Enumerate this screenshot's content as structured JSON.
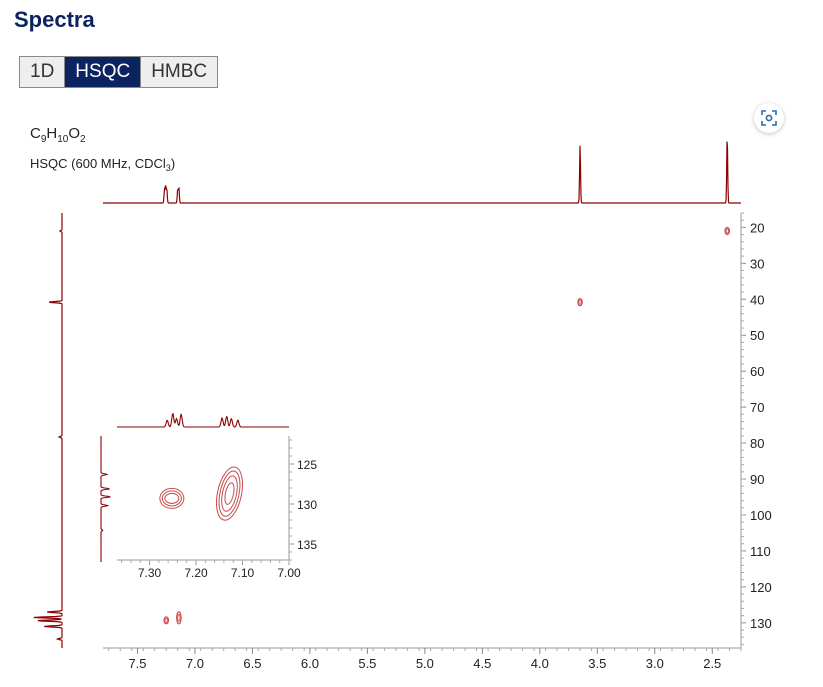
{
  "page": {
    "title": "Spectra"
  },
  "tabs": [
    {
      "label": "1D",
      "active": false
    },
    {
      "label": "HSQC",
      "active": true
    },
    {
      "label": "HMBC",
      "active": false
    }
  ],
  "toolbar": {
    "scan_icon": "focus-scan-icon"
  },
  "colors": {
    "accent": "#0b2361",
    "spectrum": "#8b0000",
    "contour": "#c84b4b"
  },
  "chart_data": {
    "type": "heatmap",
    "formula": {
      "c": "C",
      "c_n": "9",
      "h": "H",
      "h_n": "10",
      "o": "O",
      "o_n": "2"
    },
    "experiment": {
      "prefix": "HSQC (600 MHz, CDCl",
      "sub": "3",
      "suffix": ")"
    },
    "x_axis": {
      "reversed": true,
      "range": [
        7.8,
        2.25
      ],
      "ticks": [
        7.5,
        7.0,
        6.5,
        6.0,
        5.5,
        5.0,
        4.5,
        4.0,
        3.5,
        3.0,
        2.5
      ],
      "tick_labels": [
        "7.5",
        "7.0",
        "6.5",
        "6.0",
        "5.5",
        "5.0",
        "4.5",
        "4.0",
        "3.5",
        "3.0",
        "2.5"
      ]
    },
    "y_axis": {
      "reversed": true,
      "range": [
        16,
        137
      ],
      "ticks": [
        20,
        30,
        40,
        50,
        60,
        70,
        80,
        90,
        100,
        110,
        120,
        130
      ],
      "tick_labels": [
        "20",
        "30",
        "40",
        "50",
        "60",
        "70",
        "80",
        "90",
        "100",
        "110",
        "120",
        "130"
      ]
    },
    "cross_peaks": [
      {
        "h": 2.37,
        "c": 21.0
      },
      {
        "h": 3.65,
        "c": 40.8
      },
      {
        "h": 7.25,
        "c": 129.3
      },
      {
        "h": 7.14,
        "c": 128.6
      }
    ],
    "proton_1d_peaks": [
      {
        "ppm": 7.265,
        "rel_height": 0.2
      },
      {
        "ppm": 7.255,
        "rel_height": 0.25
      },
      {
        "ppm": 7.245,
        "rel_height": 0.2
      },
      {
        "ppm": 7.15,
        "rel_height": 0.2
      },
      {
        "ppm": 7.14,
        "rel_height": 0.22
      },
      {
        "ppm": 3.65,
        "rel_height": 0.85
      },
      {
        "ppm": 2.37,
        "rel_height": 1.0
      }
    ],
    "carbon_1d_peaks": [
      {
        "ppm": 21.0,
        "rel_height": 0.07
      },
      {
        "ppm": 40.8,
        "rel_height": 0.45
      },
      {
        "ppm": 78.3,
        "rel_height": 0.1
      },
      {
        "ppm": 127.0,
        "rel_height": 0.5
      },
      {
        "ppm": 128.5,
        "rel_height": 0.95
      },
      {
        "ppm": 129.4,
        "rel_height": 0.85
      },
      {
        "ppm": 131.0,
        "rel_height": 0.6
      },
      {
        "ppm": 134.5,
        "rel_height": 0.15
      }
    ],
    "inset": {
      "x_range": [
        7.37,
        7.0
      ],
      "x_ticks": [
        7.3,
        7.2,
        7.1,
        7.0
      ],
      "x_tick_labels": [
        "7.30",
        "7.20",
        "7.10",
        "7.00"
      ],
      "y_range": [
        121.5,
        137.0
      ],
      "y_ticks": [
        125,
        130,
        135
      ],
      "y_tick_labels": [
        "125",
        "130",
        "135"
      ],
      "proton_1d_peaks": [
        {
          "ppm": 7.262,
          "rel_height": 0.45
        },
        {
          "ppm": 7.25,
          "rel_height": 0.9
        },
        {
          "ppm": 7.242,
          "rel_height": 0.55
        },
        {
          "ppm": 7.232,
          "rel_height": 0.85
        },
        {
          "ppm": 7.144,
          "rel_height": 0.6
        },
        {
          "ppm": 7.134,
          "rel_height": 0.7
        },
        {
          "ppm": 7.124,
          "rel_height": 0.55
        },
        {
          "ppm": 7.11,
          "rel_height": 0.45
        }
      ],
      "carbon_1d_peaks": [
        {
          "ppm": 126.3,
          "rel_height": 0.35
        },
        {
          "ppm": 128.1,
          "rel_height": 0.5
        },
        {
          "ppm": 129.1,
          "rel_height": 0.55
        },
        {
          "ppm": 130.2,
          "rel_height": 0.4
        },
        {
          "ppm": 133.3,
          "rel_height": 0.1
        }
      ],
      "cross_peaks": [
        {
          "h": 7.252,
          "c": 129.3,
          "shape": "round"
        },
        {
          "h": 7.128,
          "c": 128.7,
          "shape": "elongated"
        }
      ]
    }
  }
}
